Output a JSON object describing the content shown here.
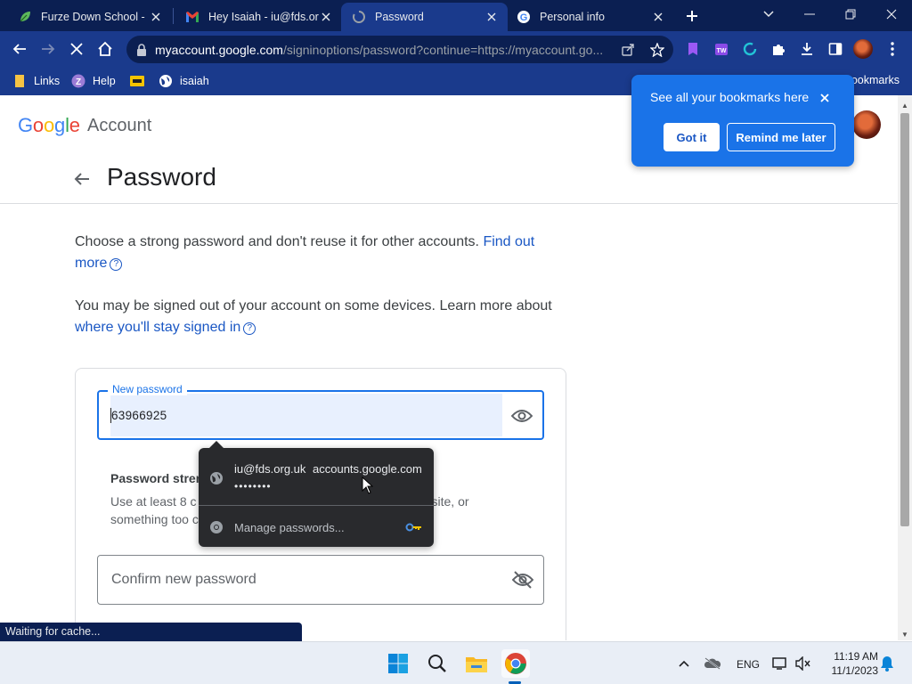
{
  "tabs": [
    {
      "title": "Furze Down School - H",
      "icon": "leaf-icon"
    },
    {
      "title": "Hey Isaiah - iu@fds.or",
      "icon": "gmail-icon"
    },
    {
      "title": "Password",
      "icon": "loading-icon",
      "active": true
    },
    {
      "title": "Personal info",
      "icon": "google-icon"
    }
  ],
  "address_bar": {
    "host": "myaccount.google.com",
    "path": "/signinoptions/password?continue=https://myaccount.go..."
  },
  "bookmarks": [
    {
      "label": "Links",
      "icon": "folder-icon"
    },
    {
      "label": "Help",
      "icon": "help-icon"
    },
    {
      "label": "",
      "icon": "bookmark-yellow-icon"
    },
    {
      "label": "isaiah",
      "icon": "globe-icon"
    }
  ],
  "bookmarks_all_label": "ookmarks",
  "bookmark_bubble": {
    "text": "See all your bookmarks here",
    "got_it": "Got it",
    "remind_later": "Remind me later"
  },
  "header": {
    "logo": [
      "G",
      "o",
      "o",
      "g",
      "l",
      "e"
    ],
    "logo_colors": [
      "#4285f4",
      "#ea4335",
      "#fbbc05",
      "#4285f4",
      "#34a853",
      "#ea4335"
    ],
    "account_label": "Account"
  },
  "page": {
    "title": "Password",
    "para1_text": "Choose a strong password and don't reuse it for other accounts. ",
    "para1_link_a": "Find out",
    "para1_link_b": "more",
    "para2_text": "You may be signed out of your account on some devices. Learn more about ",
    "para2_link": "where you'll stay signed in",
    "help_glyph": "?"
  },
  "form": {
    "new_password_label": "New password",
    "new_password_value": "63966925",
    "strength_title": "Password stren",
    "strength_desc_a": "Use at least 8 c",
    "strength_desc_b": "ther site, or",
    "strength_desc_c": "something too c",
    "confirm_placeholder": "Confirm new password"
  },
  "autofill": {
    "user": "iu@fds.org.uk",
    "site": "accounts.google.com",
    "masked_password": "••••••••",
    "manage_label": "Manage passwords..."
  },
  "status_text": "Waiting for cache...",
  "taskbar": {
    "apps": [
      "windows-start-icon",
      "search-icon",
      "file-explorer-icon",
      "chrome-icon"
    ],
    "language": "ENG",
    "time": "11:19 AM",
    "date": "11/1/2023"
  },
  "colors": {
    "frame": "#0b1f52",
    "toolbar": "#1a3a8c",
    "accent": "#1a73e8",
    "link": "#1a57c4"
  }
}
